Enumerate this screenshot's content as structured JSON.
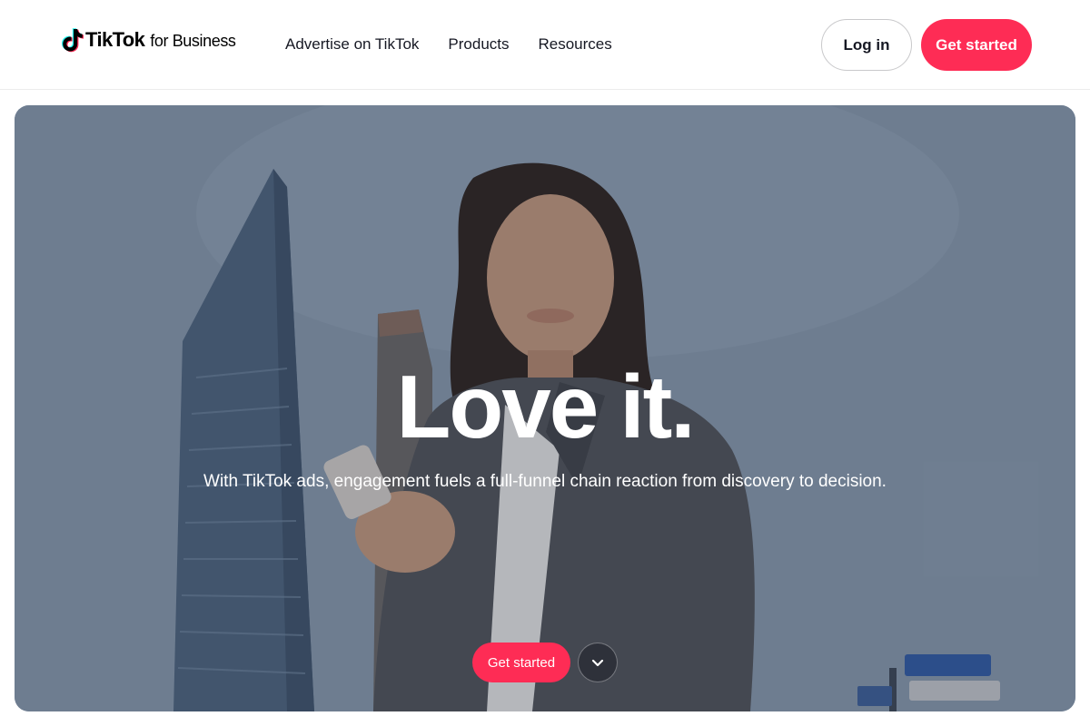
{
  "brand": {
    "name": "TikTok",
    "suffix": "for Business",
    "accent_color": "#fe2c55"
  },
  "nav": {
    "items": [
      {
        "label": "Advertise on TikTok"
      },
      {
        "label": "Products"
      },
      {
        "label": "Resources"
      }
    ]
  },
  "header_actions": {
    "login_label": "Log in",
    "get_started_label": "Get started"
  },
  "hero": {
    "title": "Love it.",
    "subtitle": "With TikTok ads, engagement fuels a full-funnel chain reaction from discovery to decision.",
    "cta_label": "Get started",
    "scroll_icon": "chevron-down-icon"
  }
}
